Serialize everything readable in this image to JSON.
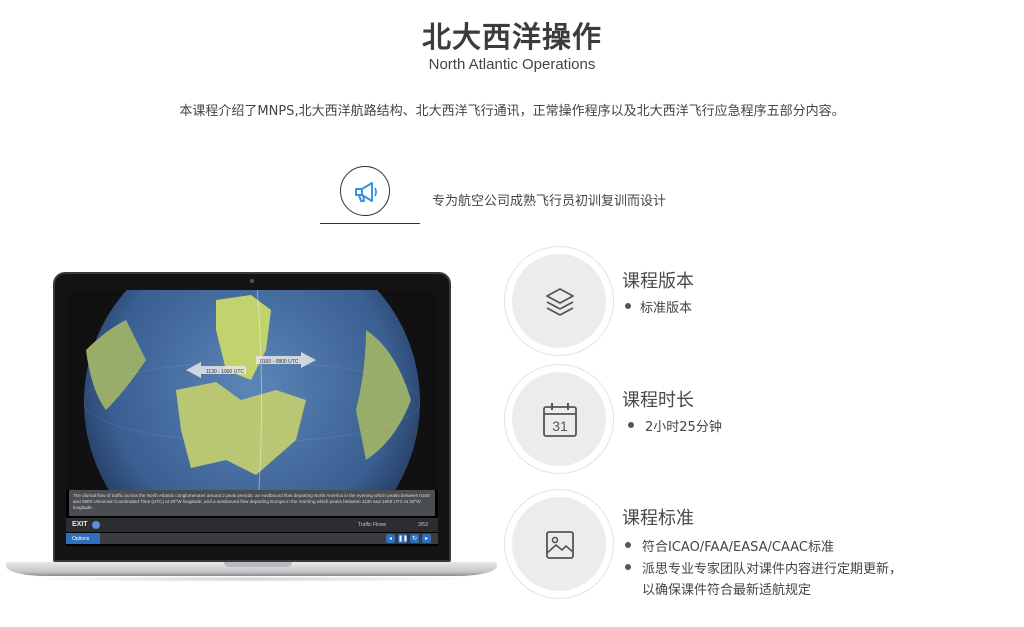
{
  "header": {
    "title": "北大西洋操作",
    "subtitle": "North Atlantic Operations",
    "intro": "本课程介绍了MNPS,北大西洋航路结构、北大西洋飞行通讯，正常操作程序以及北大西洋飞行应急程序五部分内容。"
  },
  "feature": {
    "icon": "megaphone-icon",
    "text": "专为航空公司成熟飞行员初训复训而设计"
  },
  "screen": {
    "arrow_label_left": "1130 - 1900 UTC",
    "arrow_label_right": "0100 - 0800 UTC",
    "caption": "The diurnal flow of traffic across the North Atlantic conglomerates around 2 peak periods: an eastbound flow departing North America in the evening which peaks between 0100 and 0800 Universal Coordinated Time (UTC) at 30°W longitude, and a westbound flow departing Europe in the morning which peaks between 1130 and 1900 UTC at 30°W longitude.",
    "exit_label": "EXIT",
    "section_label": "Traffic Flows",
    "page_count": "3/53",
    "options_label": "Options"
  },
  "info": [
    {
      "icon": "layers-icon",
      "title": "课程版本",
      "bullets": [
        "标准版本"
      ]
    },
    {
      "icon": "calendar-icon",
      "title": "课程时长",
      "bullets": [
        "2小时25分钟"
      ],
      "calendar_day": "31"
    },
    {
      "icon": "image-icon",
      "title": "课程标准",
      "bullets": [
        "符合ICAO/FAA/EASA/CAAC标准",
        "派思专业专家团队对课件内容进行定期更新，",
        "以确保课件符合最新适航规定"
      ]
    }
  ],
  "colors": {
    "accent_blue": "#2f6fb8",
    "icon_blue": "#3d8fe0"
  }
}
